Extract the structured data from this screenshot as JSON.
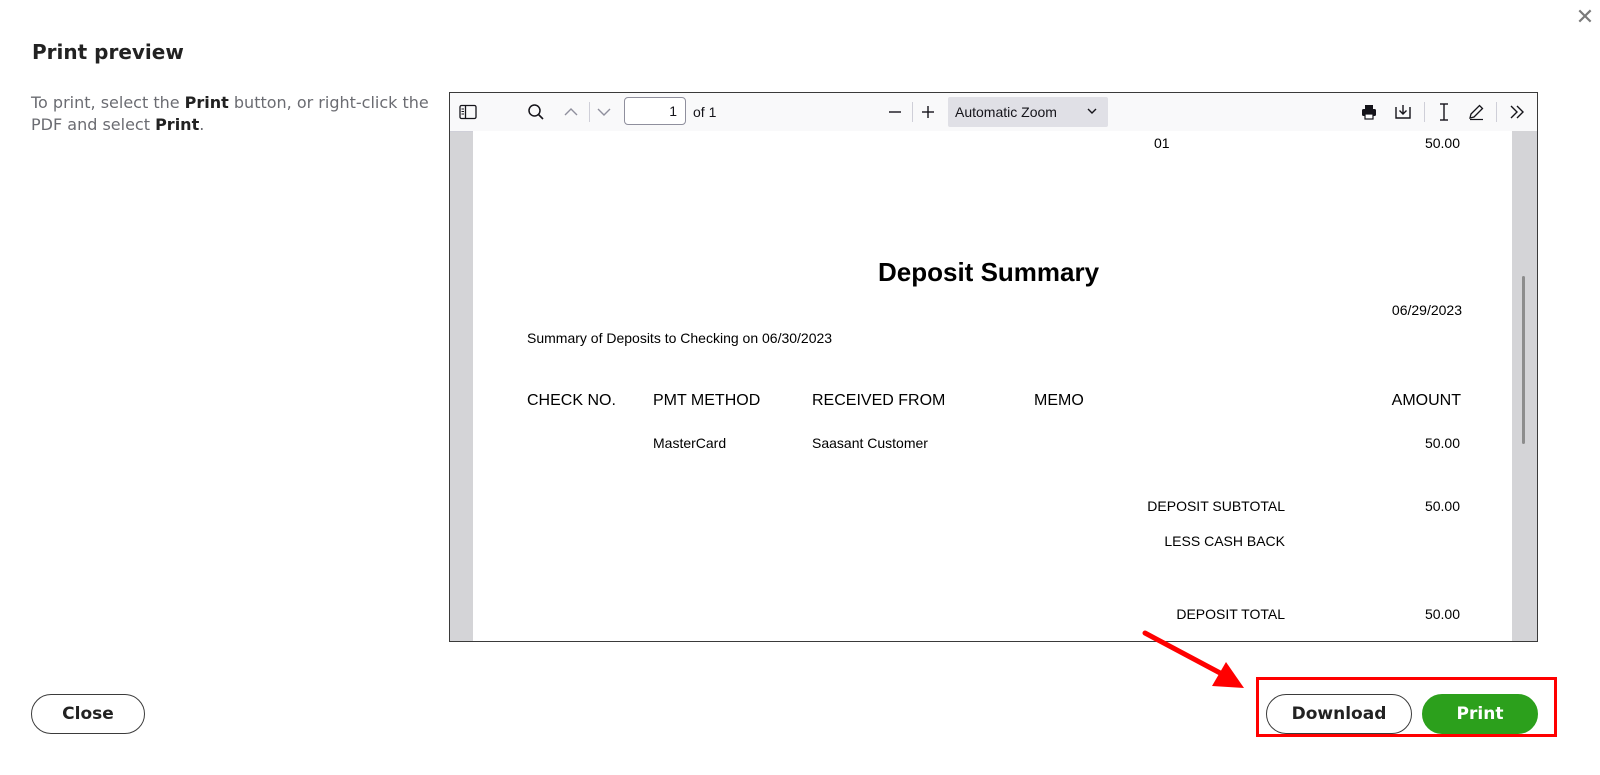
{
  "dialog": {
    "title": "Print preview",
    "close_glyph": "✕",
    "instructions": {
      "part1": "To print, select the ",
      "bold1": "Print",
      "part2": " button, or right-click the PDF and select ",
      "bold2": "Print",
      "part3": "."
    }
  },
  "viewer": {
    "toolbar": {
      "page_number": "1",
      "page_count": "of 1",
      "zoom": "Automatic Zoom",
      "icons": [
        "sidebar-toggle-icon",
        "search-icon",
        "chevron-up-icon",
        "chevron-down-icon",
        "zoom-out-icon",
        "zoom-in-icon",
        "chevron-down-icon",
        "print-icon",
        "download-icon",
        "text-cursor-icon",
        "pen-icon",
        "double-chevron-right-icon"
      ]
    },
    "document": {
      "top_row": {
        "ref": "01",
        "amount": "50.00"
      },
      "heading": "Deposit Summary",
      "date": "06/29/2023",
      "summary_line": "Summary of Deposits to Checking on 06/30/2023",
      "columns": [
        "CHECK NO.",
        "PMT METHOD",
        "RECEIVED FROM",
        "MEMO",
        "AMOUNT"
      ],
      "rows": [
        {
          "check_no": "",
          "pmt_method": "MasterCard",
          "received_from": "Saasant Customer",
          "memo": "",
          "amount": "50.00"
        }
      ],
      "totals": {
        "subtotal_label": "DEPOSIT SUBTOTAL",
        "subtotal_value": "50.00",
        "cashback_label": "LESS CASH BACK",
        "total_label": "DEPOSIT TOTAL",
        "total_value": "50.00"
      }
    }
  },
  "buttons": {
    "close": "Close",
    "download": "Download",
    "print": "Print"
  },
  "colors": {
    "print_green": "#2ca01c",
    "annotation_red": "#ff0000"
  }
}
